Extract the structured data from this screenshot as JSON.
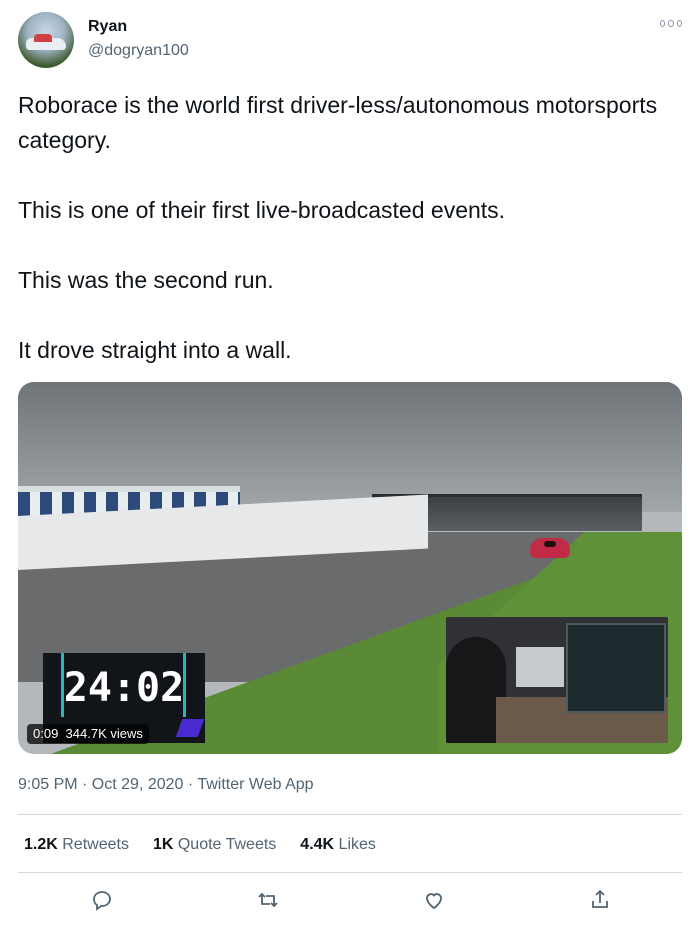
{
  "author": {
    "name": "Ryan",
    "handle": "@dogryan100"
  },
  "tweet": {
    "text": "Roborace is the world first driver-less/autonomous motorsports category.\n\nThis is one of their first live-broadcasted events.\n\nThis was the second run.\n\nIt drove straight into a wall."
  },
  "video": {
    "timer": "24:02",
    "time_elapsed": "0:09",
    "views": "344.7K views"
  },
  "meta": {
    "timestamp": "9:05 PM · Oct 29, 2020 · Twitter Web App"
  },
  "stats": {
    "retweets_count": "1.2K",
    "retweets_label": "Retweets",
    "quote_count": "1K",
    "quote_label": "Quote Tweets",
    "likes_count": "4.4K",
    "likes_label": "Likes"
  },
  "actions": [
    "reply-icon",
    "retweet-icon",
    "like-icon",
    "share-icon"
  ],
  "colors": {
    "text_primary": "#0f1419",
    "text_secondary": "#536471",
    "divider": "#cfd9de",
    "icon": "#536471"
  }
}
